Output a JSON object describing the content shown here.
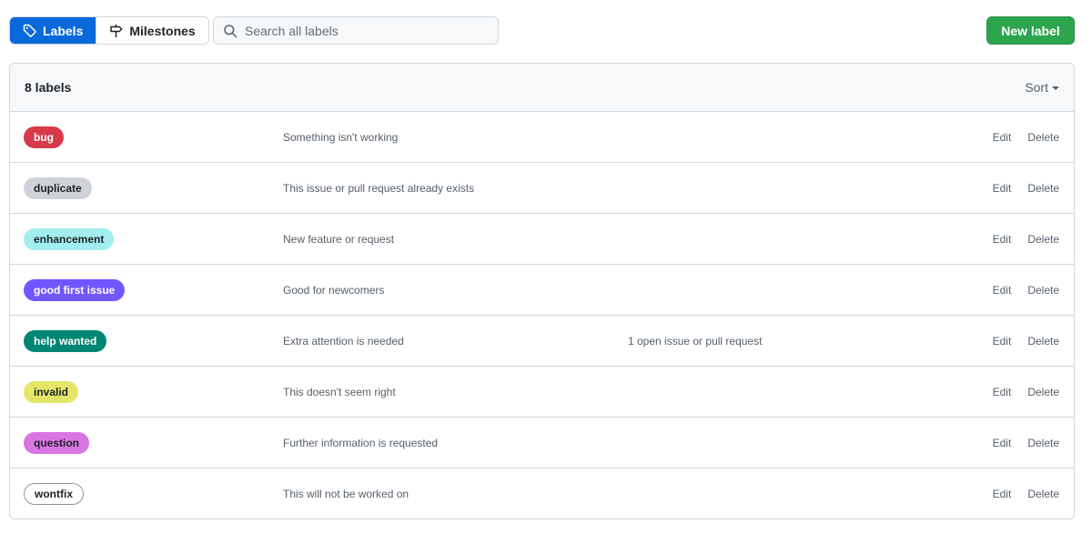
{
  "toolbar": {
    "labels_tab": "Labels",
    "milestones_tab": "Milestones",
    "search_placeholder": "Search all labels",
    "new_label": "New label"
  },
  "list": {
    "count": "8 labels",
    "sort": "Sort",
    "edit": "Edit",
    "delete": "Delete"
  },
  "labels": [
    {
      "name": "bug",
      "description": "Something isn't working",
      "issues": "",
      "bg": "#d73a4a",
      "fg": "#ffffff"
    },
    {
      "name": "duplicate",
      "description": "This issue or pull request already exists",
      "issues": "",
      "bg": "#cfd3d7",
      "fg": "#1f2328"
    },
    {
      "name": "enhancement",
      "description": "New feature or request",
      "issues": "",
      "bg": "#a2eeef",
      "fg": "#1f2328"
    },
    {
      "name": "good first issue",
      "description": "Good for newcomers",
      "issues": "",
      "bg": "#7057ff",
      "fg": "#ffffff"
    },
    {
      "name": "help wanted",
      "description": "Extra attention is needed",
      "issues": "1 open issue or pull request",
      "bg": "#008672",
      "fg": "#ffffff"
    },
    {
      "name": "invalid",
      "description": "This doesn't seem right",
      "issues": "",
      "bg": "#e4e669",
      "fg": "#1f2328"
    },
    {
      "name": "question",
      "description": "Further information is requested",
      "issues": "",
      "bg": "#d876e3",
      "fg": "#1f2328"
    },
    {
      "name": "wontfix",
      "description": "This will not be worked on",
      "issues": "",
      "bg": "#ffffff",
      "fg": "#1f2328"
    }
  ]
}
